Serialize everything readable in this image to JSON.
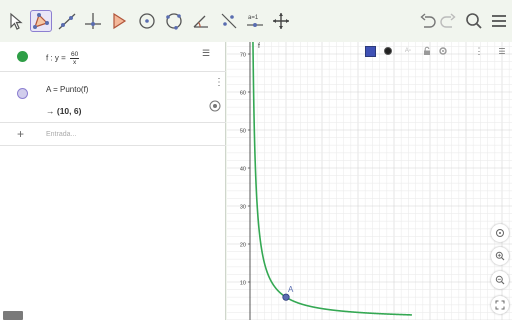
{
  "toolbar": {
    "tools": [
      "move-tool",
      "point-tool",
      "line-tool",
      "perpendicular-tool",
      "polygon-tool",
      "circle-center-tool",
      "circle-three-points-tool",
      "angle-tool",
      "reflect-tool",
      "slider-tool",
      "move-graphics-tool"
    ],
    "slider_label": "a=1"
  },
  "algebra": {
    "items": [
      {
        "prefix": "f : y =",
        "numerator": "60",
        "denominator": "x",
        "color": "#2e9e46"
      },
      {
        "definition": "A = Punto(f)",
        "value": "→ (10, 6)",
        "color": "#8c7fd1"
      }
    ],
    "input_placeholder": "Entrada..."
  },
  "graphics": {
    "y_axis_label": "f",
    "point_label": "A",
    "y_ticks": [
      "70",
      "60",
      "50",
      "40",
      "30",
      "20",
      "10"
    ]
  },
  "chart_data": {
    "type": "line",
    "series": [
      {
        "name": "f",
        "function": "y = 60/x",
        "color": "#34a853"
      }
    ],
    "points": [
      {
        "name": "A",
        "x": 10,
        "y": 6,
        "color": "#5a6db0"
      }
    ],
    "ylim": [
      0,
      73
    ],
    "xlim": [
      0,
      45
    ],
    "y_ticks": [
      10,
      20,
      30,
      40,
      50,
      60,
      70
    ],
    "grid": true
  },
  "colors": {
    "function": "#34a853",
    "point": "#5a6db0",
    "accent": "#8c7fd1",
    "style_color": "#3f51b5"
  }
}
